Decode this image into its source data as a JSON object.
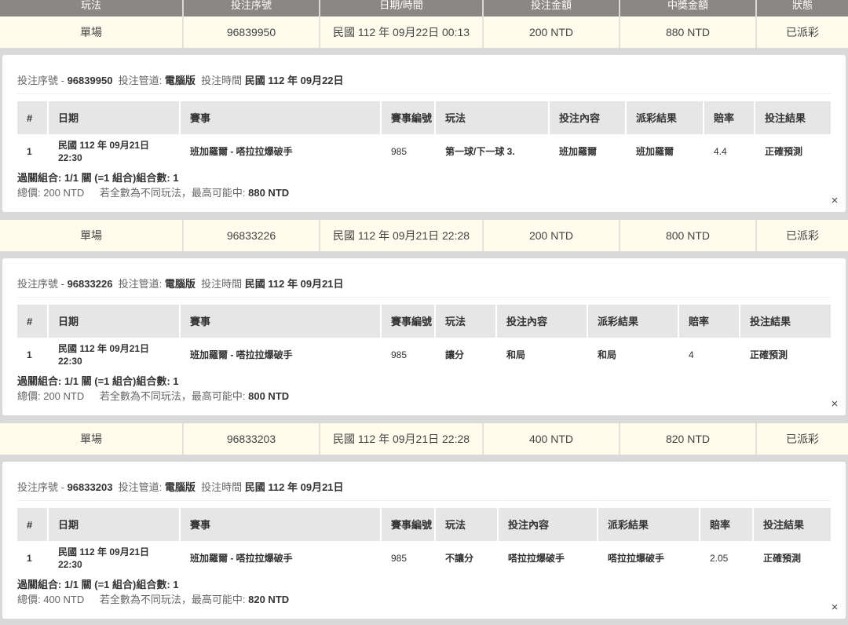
{
  "header": [
    "玩法",
    "投注序號",
    "日期/時間",
    "投注金額",
    "中獎金額",
    "狀態"
  ],
  "bets": [
    {
      "row": [
        "單場",
        "96839950",
        "民國 112 年 09月22日 00:13",
        "200 NTD",
        "880 NTD",
        "已派彩"
      ],
      "info": {
        "serial_label": "投注序號 -",
        "serial": "96839950",
        "channel_label": "投注管道:",
        "channel": "電腦版",
        "time_label": "投注時間",
        "time": "民國 112 年 09月22日"
      },
      "columns": [
        "#",
        "日期",
        "賽事",
        "賽事編號",
        "玩法",
        "投注內容",
        "派彩結果",
        "賠率",
        "投注結果"
      ],
      "line": {
        "no": "1",
        "date": "民國 112 年 09月21日",
        "time": "22:30",
        "event": "班加羅爾 - 嗒拉拉爆破手",
        "event_no": "985",
        "play": "第一球/下一球 3.",
        "content": "班加羅爾",
        "result": "班加羅爾",
        "odds": "4.4",
        "outcome": "正確預測"
      },
      "combo": "過關組合: 1/1 關 (=1 組合)組合數: 1",
      "total_label": "總價: 200 NTD",
      "max_label": "若全數為不同玩法，最高可能中:",
      "max_value": "880 NTD",
      "close": "×"
    },
    {
      "row": [
        "單場",
        "96833226",
        "民國 112 年 09月21日 22:28",
        "200 NTD",
        "800 NTD",
        "已派彩"
      ],
      "info": {
        "serial_label": "投注序號 -",
        "serial": "96833226",
        "channel_label": "投注管道:",
        "channel": "電腦版",
        "time_label": "投注時間",
        "time": "民國 112 年 09月21日"
      },
      "columns": [
        "#",
        "日期",
        "賽事",
        "賽事編號",
        "玩法",
        "投注內容",
        "派彩結果",
        "賠率",
        "投注結果"
      ],
      "line": {
        "no": "1",
        "date": "民國 112 年 09月21日",
        "time": "22:30",
        "event": "班加羅爾 - 嗒拉拉爆破手",
        "event_no": "985",
        "play": "讓分",
        "content": "和局",
        "result": "和局",
        "odds": "4",
        "outcome": "正確預測"
      },
      "combo": "過關組合: 1/1 關 (=1 組合)組合數: 1",
      "total_label": "總價: 200 NTD",
      "max_label": "若全數為不同玩法，最高可能中:",
      "max_value": "800 NTD",
      "close": "×"
    },
    {
      "row": [
        "單場",
        "96833203",
        "民國 112 年 09月21日 22:28",
        "400 NTD",
        "820 NTD",
        "已派彩"
      ],
      "info": {
        "serial_label": "投注序號 -",
        "serial": "96833203",
        "channel_label": "投注管道:",
        "channel": "電腦版",
        "time_label": "投注時間",
        "time": "民國 112 年 09月21日"
      },
      "columns": [
        "#",
        "日期",
        "賽事",
        "賽事編號",
        "玩法",
        "投注內容",
        "派彩結果",
        "賠率",
        "投注結果"
      ],
      "line": {
        "no": "1",
        "date": "民國 112 年 09月21日",
        "time": "22:30",
        "event": "班加羅爾 - 嗒拉拉爆破手",
        "event_no": "985",
        "play": "不讓分",
        "content": "嗒拉拉爆破手",
        "result": "嗒拉拉爆破手",
        "odds": "2.05",
        "outcome": "正確預測"
      },
      "combo": "過關組合: 1/1 關 (=1 組合)組合數: 1",
      "total_label": "總價: 400 NTD",
      "max_label": "若全數為不同玩法，最高可能中:",
      "max_value": "820 NTD",
      "close": "×"
    }
  ]
}
